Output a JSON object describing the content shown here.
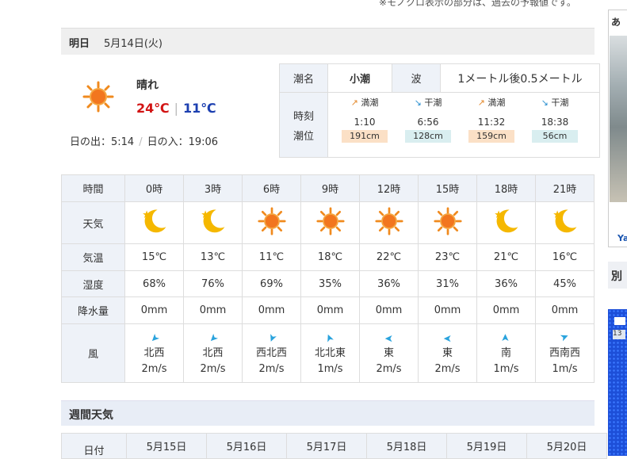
{
  "note": "※モノクロ表示の部分は、過去の予報値です。",
  "tomorrow": {
    "label": "明日",
    "date": "5月14日(火)",
    "condition": "晴れ",
    "icon": "sun-icon",
    "high": "24℃",
    "low": "11℃",
    "sunrise": "日の出：5:14",
    "sunset": "日の入：19:06"
  },
  "tide": {
    "name_label": "潮名",
    "name": "小潮",
    "wave_label": "波",
    "wave": "1メートル後0.5メートル",
    "time_label": "時刻",
    "level_label": "潮位",
    "entries": [
      {
        "type": "満潮",
        "dir": "up",
        "time": "1:10",
        "level": "191cm"
      },
      {
        "type": "干潮",
        "dir": "down",
        "time": "6:56",
        "level": "128cm"
      },
      {
        "type": "満潮",
        "dir": "up",
        "time": "11:32",
        "level": "159cm"
      },
      {
        "type": "干潮",
        "dir": "down",
        "time": "18:38",
        "level": "56cm"
      }
    ]
  },
  "hourly": {
    "labels": {
      "time": "時間",
      "weather": "天気",
      "temp": "気温",
      "humidity": "湿度",
      "precip": "降水量",
      "wind": "風"
    },
    "hours": [
      "0時",
      "3時",
      "6時",
      "9時",
      "12時",
      "15時",
      "18時",
      "21時"
    ],
    "weather": [
      "moon-icon",
      "moon-icon",
      "sun-icon",
      "sun-icon",
      "sun-icon",
      "sun-icon",
      "moon-icon",
      "moon-icon"
    ],
    "temps": [
      "15℃",
      "13℃",
      "11℃",
      "18℃",
      "22℃",
      "23℃",
      "21℃",
      "16℃"
    ],
    "humidity": [
      "68%",
      "76%",
      "69%",
      "35%",
      "36%",
      "31%",
      "36%",
      "45%"
    ],
    "precip": [
      "0mm",
      "0mm",
      "0mm",
      "0mm",
      "0mm",
      "0mm",
      "0mm",
      "0mm"
    ],
    "wind_dir": [
      "北西",
      "北西",
      "西北西",
      "北北東",
      "東",
      "東",
      "南",
      "西南西"
    ],
    "wind_speed": [
      "2m/s",
      "2m/s",
      "2m/s",
      "1m/s",
      "2m/s",
      "2m/s",
      "1m/s",
      "1m/s"
    ]
  },
  "weekly": {
    "title": "週間天気",
    "row_label": "日付",
    "dates": [
      "5月15日",
      "5月16日",
      "5月17日",
      "5月18日",
      "5月19日",
      "5月20日"
    ]
  },
  "sidebar": {
    "ad_title": "あ",
    "ad_link": "Ya",
    "section2": "別",
    "map_label": "13"
  },
  "colors": {
    "high": "#d21414",
    "low": "#1c3fb0",
    "sun": "#f08a1e",
    "moon": "#f5b800",
    "wind_arrow": "#2aa3dd",
    "header_bg": "#eef2f8"
  }
}
